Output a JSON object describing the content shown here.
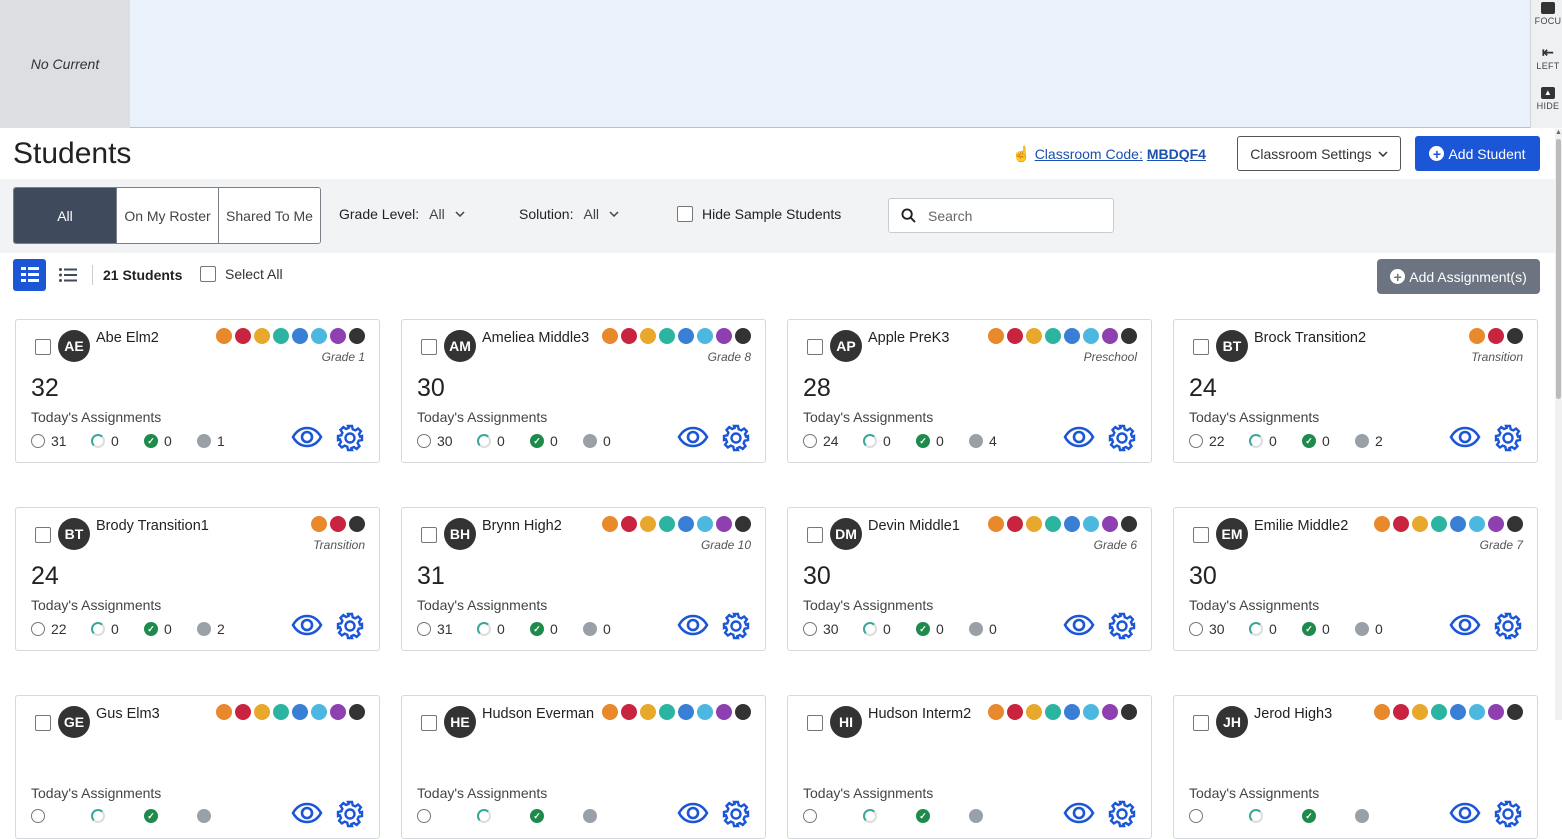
{
  "top": {
    "no_current": "No Current"
  },
  "right_tools": {
    "focus": "FOCU",
    "left": "LEFT",
    "hide": "HIDE"
  },
  "header": {
    "title": "Students",
    "classroom_code_label": "Classroom Code:",
    "classroom_code_value": "MBDQF4",
    "settings_label": "Classroom Settings",
    "add_student_label": "Add Student"
  },
  "filters": {
    "segments": [
      "All",
      "On My Roster",
      "Shared To Me"
    ],
    "grade_level_label": "Grade Level:",
    "grade_level_value": "All",
    "solution_label": "Solution:",
    "solution_value": "All",
    "hide_sample_label": "Hide Sample Students",
    "search_placeholder": "Search"
  },
  "toolbar": {
    "count": "21 Students",
    "select_all": "Select All",
    "add_assignments": "Add Assignment(s)"
  },
  "colors": {
    "primary": "#1a56d6",
    "segment_active": "#3f4a5c",
    "solution_dots": [
      "#e8892b",
      "#c8233f",
      "#e8a82b",
      "#2bb5a0",
      "#3a7fd6",
      "#4cb8e0",
      "#8e3fb0",
      "#333333"
    ]
  },
  "card_label": "Today's Assignments",
  "students": [
    {
      "initials": "AE",
      "name": "Abe Elm2",
      "grade": "Grade 1",
      "total": "32",
      "open": "31",
      "progress": "0",
      "done": "0",
      "other": "1",
      "solutions": 8
    },
    {
      "initials": "AM",
      "name": "Ameliea Middle3",
      "grade": "Grade 8",
      "total": "30",
      "open": "30",
      "progress": "0",
      "done": "0",
      "other": "0",
      "solutions": 8
    },
    {
      "initials": "AP",
      "name": "Apple PreK3",
      "grade": "Preschool",
      "total": "28",
      "open": "24",
      "progress": "0",
      "done": "0",
      "other": "4",
      "solutions": 8
    },
    {
      "initials": "BT",
      "name": "Brock Transition2",
      "grade": "Transition",
      "total": "24",
      "open": "22",
      "progress": "0",
      "done": "0",
      "other": "2",
      "solutions": 3
    },
    {
      "initials": "BT",
      "name": "Brody Transition1",
      "grade": "Transition",
      "total": "24",
      "open": "22",
      "progress": "0",
      "done": "0",
      "other": "2",
      "solutions": 3
    },
    {
      "initials": "BH",
      "name": "Brynn High2",
      "grade": "Grade 10",
      "total": "31",
      "open": "31",
      "progress": "0",
      "done": "0",
      "other": "0",
      "solutions": 8
    },
    {
      "initials": "DM",
      "name": "Devin Middle1",
      "grade": "Grade 6",
      "total": "30",
      "open": "30",
      "progress": "0",
      "done": "0",
      "other": "0",
      "solutions": 8
    },
    {
      "initials": "EM",
      "name": "Emilie Middle2",
      "grade": "Grade 7",
      "total": "30",
      "open": "30",
      "progress": "0",
      "done": "0",
      "other": "0",
      "solutions": 8
    },
    {
      "initials": "GE",
      "name": "Gus Elm3",
      "grade": "",
      "total": "",
      "open": "",
      "progress": "",
      "done": "",
      "other": "",
      "solutions": 8
    },
    {
      "initials": "HE",
      "name": "Hudson Everman",
      "grade": "",
      "total": "",
      "open": "",
      "progress": "",
      "done": "",
      "other": "",
      "solutions": 8
    },
    {
      "initials": "HI",
      "name": "Hudson Interm2",
      "grade": "",
      "total": "",
      "open": "",
      "progress": "",
      "done": "",
      "other": "",
      "solutions": 8
    },
    {
      "initials": "JH",
      "name": "Jerod High3",
      "grade": "",
      "total": "",
      "open": "",
      "progress": "",
      "done": "",
      "other": "",
      "solutions": 8
    }
  ]
}
